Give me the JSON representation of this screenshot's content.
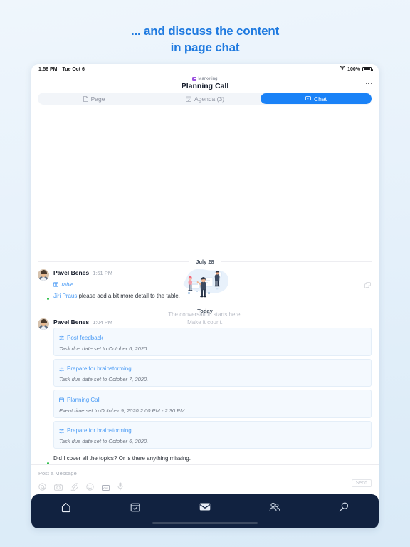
{
  "promo": {
    "line1": "... and discuss the content",
    "line2": "in page chat"
  },
  "statusbar": {
    "time": "1:56 PM",
    "date": "Tue Oct 6",
    "battery": "100%",
    "wifi_icon": "wifi-icon",
    "battery_icon": "battery-icon"
  },
  "header": {
    "space": "Marketing",
    "title": "Planning Call",
    "more_icon": "more-options-icon"
  },
  "tabs": [
    {
      "label": "Page",
      "icon": "page-icon",
      "active": false
    },
    {
      "label": "Agenda (3)",
      "icon": "agenda-icon",
      "active": false
    },
    {
      "label": "Chat",
      "icon": "chat-icon",
      "active": true
    }
  ],
  "empty_state": {
    "line1": "The conversation starts here.",
    "line2": "Make it count.",
    "illustration": "people-discussing-illustration"
  },
  "conversation": [
    {
      "date_label": "July 28",
      "messages": [
        {
          "author": "Pavel Benes",
          "time": "1:51 PM",
          "status": "online",
          "attachment": {
            "icon": "table-icon",
            "label": "Table"
          },
          "mention": "Jiri Praus",
          "text": " please add a bit more detail to the table.",
          "reaction_icon": "add-reaction-icon"
        }
      ]
    },
    {
      "date_label": "Today",
      "messages": [
        {
          "author": "Pavel Benes",
          "time": "1:04 PM",
          "status": "online",
          "cards": [
            {
              "icon": "task-icon",
              "title": "Post feedback",
              "subtitle": "Task due date set to October 6, 2020."
            },
            {
              "icon": "task-icon",
              "title": "Prepare for brainstorming",
              "subtitle": "Task due date set to October 7, 2020."
            },
            {
              "icon": "event-icon",
              "title": "Planning Call",
              "subtitle": "Event time set to October 9, 2020 2:00 PM - 2:30 PM."
            },
            {
              "icon": "task-icon",
              "title": "Prepare for brainstorming",
              "subtitle": "Task due date set to October 6, 2020."
            }
          ],
          "closing_text": "Did I cover all the topics? Or is there anything missing."
        }
      ]
    }
  ],
  "composer": {
    "placeholder": "Post a Message",
    "send_label": "Send",
    "tools": [
      {
        "icon": "mention-icon",
        "name": "at-mention"
      },
      {
        "icon": "camera-icon",
        "name": "camera"
      },
      {
        "icon": "attachment-icon",
        "name": "attachment"
      },
      {
        "icon": "emoji-icon",
        "name": "emoji"
      },
      {
        "icon": "gif-icon",
        "name": "gif",
        "label": "GIF"
      },
      {
        "icon": "microphone-icon",
        "name": "microphone"
      }
    ]
  },
  "bottom_nav": [
    {
      "icon": "home-icon",
      "name": "home"
    },
    {
      "icon": "tasks-icon",
      "name": "tasks"
    },
    {
      "icon": "inbox-icon",
      "name": "inbox",
      "active": true
    },
    {
      "icon": "people-icon",
      "name": "people"
    },
    {
      "icon": "search-icon",
      "name": "search"
    }
  ],
  "colors": {
    "accent": "#1a82f7",
    "link": "#4a9bf5",
    "navbar": "#112240",
    "online": "#2fc04a",
    "space_badge": "#9b51e0"
  }
}
